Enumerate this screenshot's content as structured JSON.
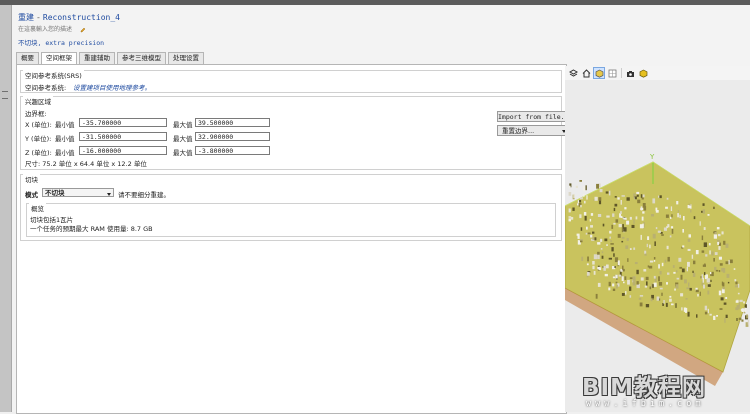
{
  "header": {
    "title_prefix": "重建",
    "title_sep": "-",
    "title_name": "Reconstruction_4",
    "description_placeholder": "在這裏輸入您的描述",
    "tiling_summary": "不切块, extra precision"
  },
  "tabs": [
    {
      "label": "概要",
      "active": false
    },
    {
      "label": "空间框架",
      "active": true
    },
    {
      "label": "重建辅助",
      "active": false
    },
    {
      "label": "参考三维模型",
      "active": false
    },
    {
      "label": "处理设置",
      "active": false
    }
  ],
  "srs": {
    "group_title": "空间参考系统(SRS)",
    "label": "空间参考系统:",
    "value": "设置建项目使用地理参考。"
  },
  "roi": {
    "group_title": "兴趣区域",
    "bounds_label": "边界框:",
    "rows": [
      {
        "axis": "X (单位):",
        "min_label": "最小值",
        "min": "-35.700000",
        "max_label": "最大值",
        "max": "39.500000"
      },
      {
        "axis": "Y (单位):",
        "min_label": "最小值",
        "min": "-31.500000",
        "max_label": "最大值",
        "max": "32.900000"
      },
      {
        "axis": "Z (单位):",
        "min_label": "最小值",
        "min": "-16.000000",
        "max_label": "最大值",
        "max": "-3.800000"
      }
    ],
    "size_text": "尺寸: 75.2 单位 x 64.4 单位 x 12.2 单位",
    "import_button": "Import from file...",
    "reset_button": "重置边界..."
  },
  "tiling": {
    "group_title": "切块",
    "mode_label": "模式",
    "mode_value": "不切块",
    "mode_note": "请不要细分重建。",
    "overview_title": "概览",
    "overview_line1": "切块包括1瓦片",
    "overview_line2": "一个任务的预期最大 RAM 使用量: 8.7 GB"
  },
  "viewport": {
    "toolbar_icons": [
      "layers-icon",
      "home-icon",
      "cube-view-icon",
      "grid-icon",
      "camera-icon",
      "settings-box-icon"
    ],
    "axis_label": "Y",
    "ground_color": "#c9c35e"
  },
  "watermark": {
    "main": "BIM教程网",
    "url": "www.ifbim.com"
  }
}
